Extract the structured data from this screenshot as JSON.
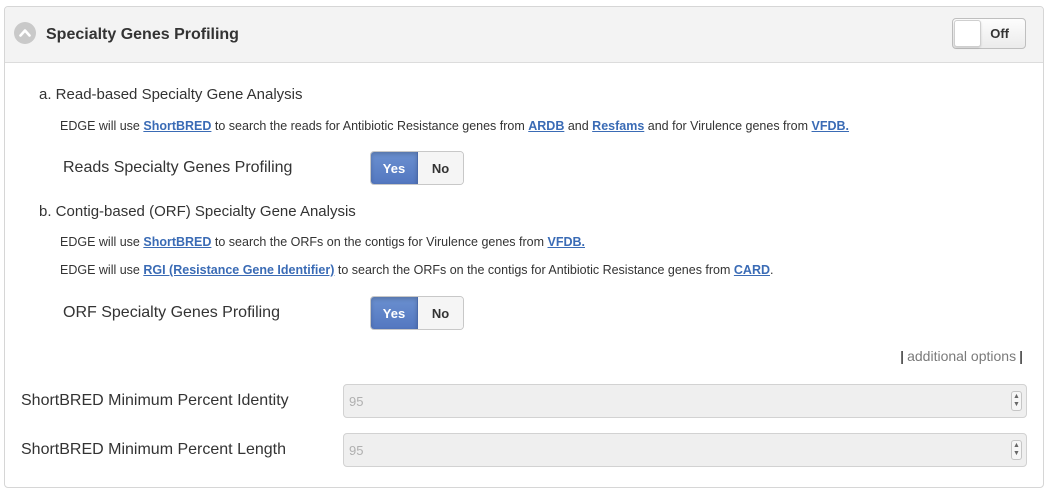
{
  "header": {
    "title": "Specialty Genes Profiling",
    "toggle_label": "Off"
  },
  "read_section": {
    "heading": "a.  Read-based Specialty Gene Analysis",
    "desc_1": "EDGE will use ",
    "link_shortbred": "ShortBRED",
    "desc_2": " to search the reads for Antibiotic Resistance genes from ",
    "link_ardb": "ARDB",
    "desc_3": " and ",
    "link_resfams": "Resfams",
    "desc_4": " and for Virulence genes from ",
    "link_vfdb": "VFDB.",
    "option_label": "Reads Specialty Genes Profiling",
    "yes_label": "Yes",
    "no_label": "No"
  },
  "contig_section": {
    "heading": "b.  Contig-based (ORF) Specialty Gene Analysis",
    "line1_desc_1": "EDGE will use ",
    "line1_link_shortbred": "ShortBRED",
    "line1_desc_2": " to search the ORFs on the contigs for Virulence genes from ",
    "line1_link_vfdb": "VFDB.",
    "line2_desc_1": "EDGE will use ",
    "line2_link_rgi": "RGI (Resistance Gene Identifier)",
    "line2_desc_2": " to search the ORFs on the contigs for Antibiotic Resistance genes from ",
    "line2_link_card": "CARD",
    "line2_desc_3": ".",
    "option_label": "ORF Specialty Genes Profiling",
    "yes_label": "Yes",
    "no_label": "No"
  },
  "additional_options": {
    "bar": "|",
    "label": "additional options"
  },
  "fields": [
    {
      "label": "ShortBRED Minimum Percent Identity",
      "value": "95"
    },
    {
      "label": "ShortBRED Minimum Percent Length",
      "value": "95"
    }
  ],
  "colors": {
    "link": "#3a6bb5",
    "yes_button": "#5b7fc6",
    "header_bg": "#f3f3f3"
  },
  "icons": {
    "collapse": "chevron-up-icon",
    "spinner_up": "▲",
    "spinner_down": "▼"
  }
}
